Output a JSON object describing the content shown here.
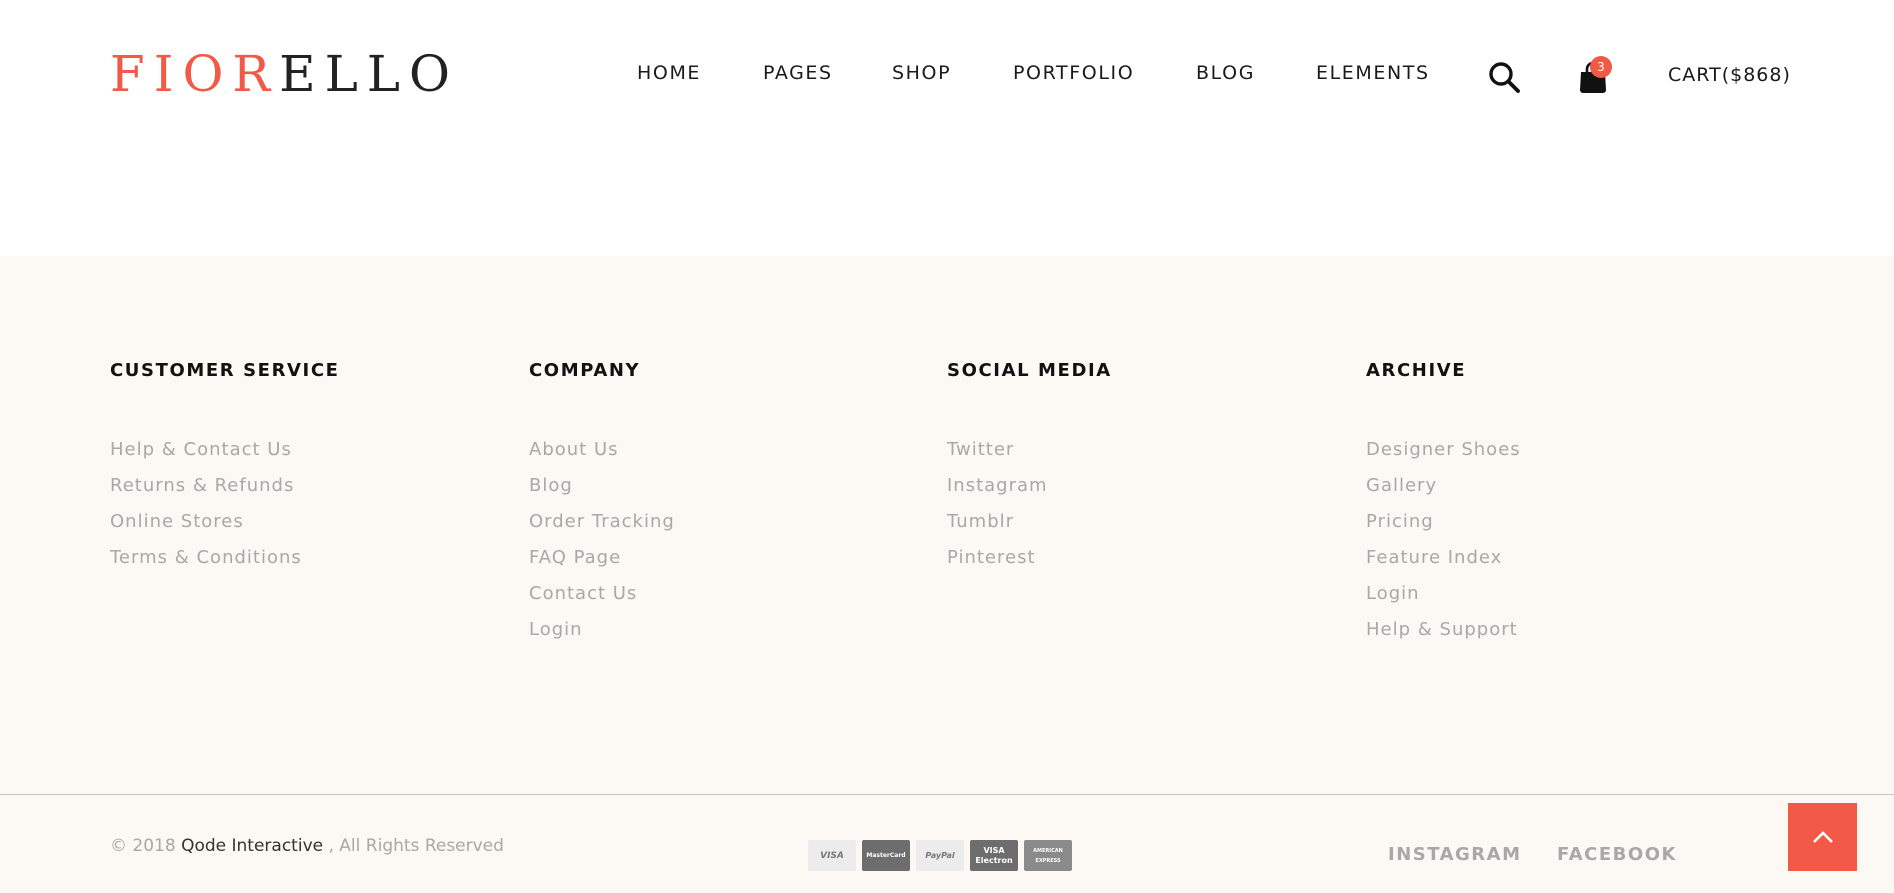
{
  "header": {
    "logo_red": "FIOR",
    "logo_dark": "ELLO",
    "nav": [
      "HOME",
      "PAGES",
      "SHOP",
      "PORTFOLIO",
      "BLOG",
      "ELEMENTS"
    ],
    "cart_count": "3",
    "cart_label": "CART($868)"
  },
  "footer": {
    "columns": [
      {
        "title": "CUSTOMER SERVICE",
        "links": [
          "Help & Contact Us",
          "Returns & Refunds",
          "Online Stores",
          "Terms & Conditions"
        ]
      },
      {
        "title": "COMPANY",
        "links": [
          "About Us",
          "Blog",
          "Order Tracking",
          "FAQ Page",
          "Contact Us",
          "Login"
        ]
      },
      {
        "title": "SOCIAL MEDIA",
        "links": [
          "Twitter",
          "Instagram",
          "Tumblr",
          "Pinterest"
        ]
      },
      {
        "title": "ARCHIVE",
        "links": [
          "Designer Shoes",
          "Gallery",
          "Pricing",
          "Feature Index",
          "Login",
          "Help & Support"
        ]
      }
    ],
    "copyright_prefix": "© 2018",
    "company": "Qode Interactive",
    "copyright_suffix": ", All Rights Reserved",
    "payments": [
      "VISA",
      "MasterCard",
      "PayPal",
      "VISA Electron",
      "AMERICAN EXPRESS"
    ],
    "social": [
      "INSTAGRAM",
      "FACEBOOK"
    ]
  },
  "colors": {
    "accent": "#f25a47",
    "footer_bg": "#fcf8f3",
    "link_gray": "#a8a8a8"
  },
  "icons": [
    "search-icon",
    "shopping-bag-icon",
    "chevron-up-icon"
  ]
}
